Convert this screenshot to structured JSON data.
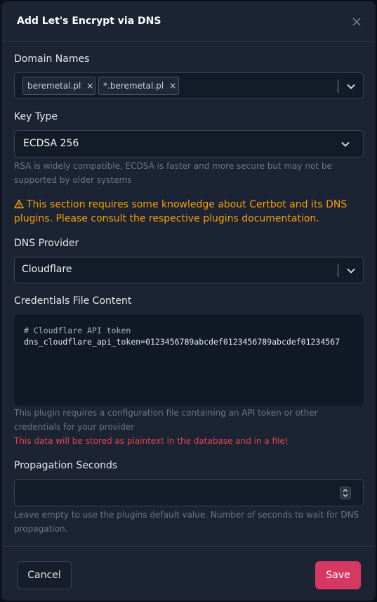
{
  "modal": {
    "title": "Add Let's Encrypt via DNS",
    "close_icon": "close-icon"
  },
  "domain_names": {
    "label": "Domain Names",
    "chips": [
      "beremetal.pl",
      "*.beremetal.pl"
    ],
    "remove_glyph": "×"
  },
  "key_type": {
    "label": "Key Type",
    "value": "ECDSA 256",
    "help": "RSA is widely compatible, ECDSA is faster and more secure but may not be supported by older systems"
  },
  "warning": {
    "icon": "warning-triangle-icon",
    "text": "This section requires some knowledge about Certbot and its DNS plugins. Please consult the respective plugins documentation."
  },
  "dns_provider": {
    "label": "DNS Provider",
    "value": "Cloudflare"
  },
  "credentials": {
    "label": "Credentials File Content",
    "line1": "# Cloudflare API token",
    "line2": "dns_cloudflare_api_token=0123456789abcdef0123456789abcdef01234567",
    "help": "This plugin requires a configuration file containing an API token or other credentials for your provider",
    "danger": "This data will be stored as plaintext in the database and in a file!"
  },
  "propagation": {
    "label": "Propagation Seconds",
    "value": "",
    "help": "Leave empty to use the plugins default value. Number of seconds to wait for DNS propagation."
  },
  "footer": {
    "cancel_label": "Cancel",
    "save_label": "Save"
  },
  "colors": {
    "accent": "#d63864",
    "warning": "#f59e0b",
    "danger": "#e0474c",
    "background": "#1c2433"
  }
}
